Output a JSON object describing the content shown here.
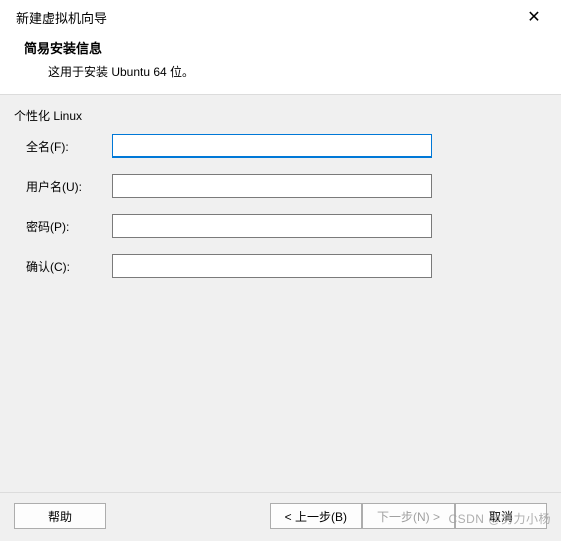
{
  "dialog": {
    "title": "新建虚拟机向导",
    "close": "✕"
  },
  "header": {
    "heading": "简易安装信息",
    "description": "这用于安装 Ubuntu 64 位。"
  },
  "form": {
    "section_label": "个性化 Linux",
    "fullname_label": "全名(F):",
    "fullname_value": "",
    "username_label": "用户名(U):",
    "username_value": "",
    "password_label": "密码(P):",
    "password_value": "",
    "confirm_label": "确认(C):",
    "confirm_value": ""
  },
  "buttons": {
    "help": "帮助",
    "back": "< 上一步(B)",
    "next": "下一步(N) >",
    "cancel": "取消"
  },
  "watermark": "CSDN @努力小杨"
}
